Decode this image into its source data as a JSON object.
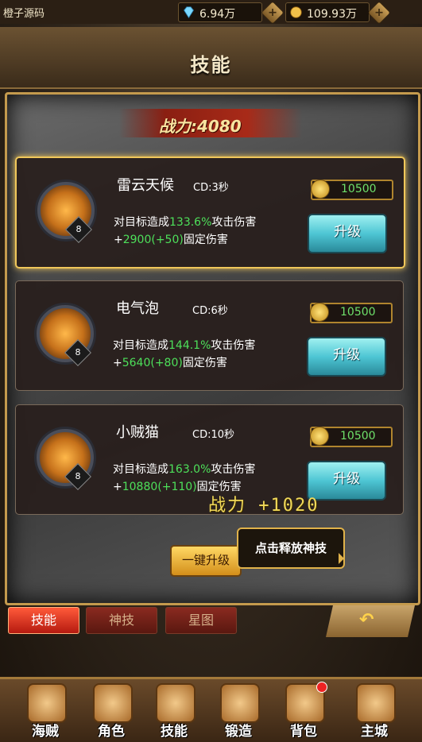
{
  "top_bar": {
    "brand": "橙子源码",
    "gems": "6.94万",
    "coins": "109.93万",
    "plus": "+"
  },
  "title": "技能",
  "power": "战力:4080",
  "skills": [
    {
      "name": "雷云天候",
      "cd": "CD:3秒",
      "cost": "10500",
      "level": "8",
      "line1_pre": "对目标造成",
      "line1_val": "133.6%",
      "line1_post": "攻击伤害",
      "line2_pre": "+",
      "line2_val": "2900(+50)",
      "line2_post": "固定伤害",
      "button": "升级",
      "selected": true
    },
    {
      "name": "电气泡",
      "cd": "CD:6秒",
      "cost": "10500",
      "level": "8",
      "line1_pre": "对目标造成",
      "line1_val": "144.1%",
      "line1_post": "攻击伤害",
      "line2_pre": "+",
      "line2_val": "5640(+80)",
      "line2_post": "固定伤害",
      "button": "升级",
      "selected": false
    },
    {
      "name": "小贼猫",
      "cd": "CD:10秒",
      "cost": "10500",
      "level": "8",
      "line1_pre": "对目标造成",
      "line1_val": "163.0%",
      "line1_post": "攻击伤害",
      "line2_pre": "+",
      "line2_val": "10880(+110)",
      "line2_post": "固定伤害",
      "button": "升级",
      "selected": false
    }
  ],
  "power_up": "战力 +1020",
  "one_key": "一键升级",
  "tip": "点击释放神技",
  "tabs": [
    "技能",
    "神技",
    "星图"
  ],
  "nav": [
    "海贼",
    "角色",
    "技能",
    "锻造",
    "背包",
    "主城"
  ],
  "colors": {
    "accent_green": "#4de05a",
    "gold": "#c49a4d"
  }
}
